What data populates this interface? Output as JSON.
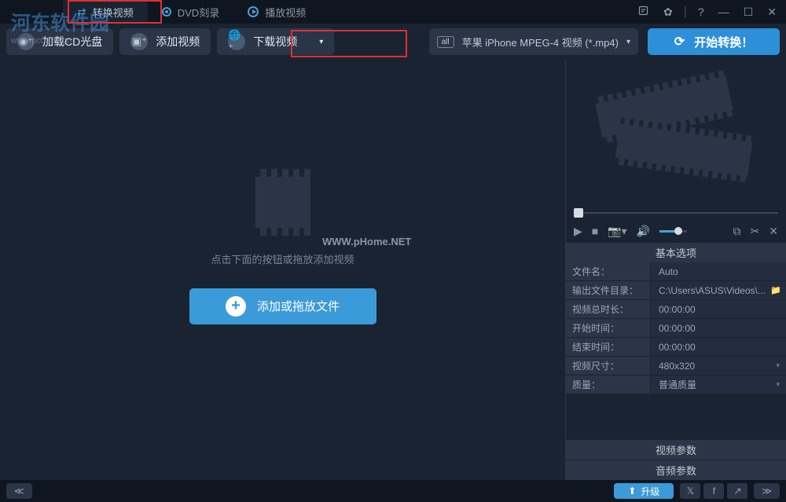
{
  "tabs": {
    "convert": "转换视频",
    "dvd": "DVD刻录",
    "play": "播放视频"
  },
  "titlebar_icons": {
    "edit": "edit-icon",
    "settings": "gear-icon",
    "help": "?",
    "minimize": "—",
    "maximize": "☐",
    "close": "✕"
  },
  "toolbar": {
    "load_cd": "加载CD光盘",
    "add_video": "添加视频",
    "download_video": "下载视频",
    "format_label": "苹果 iPhone MPEG-4 视频 (*.mp4)",
    "convert": "开始转换！"
  },
  "drop_area": {
    "hint": "点击下面的按钮或拖放添加视频",
    "button": "添加或拖放文件"
  },
  "preview": {
    "basic_options_header": "基本选项",
    "video_params_header": "视频参数",
    "audio_params_header": "音频参数"
  },
  "properties": [
    {
      "label": "文件名：",
      "value": "Auto",
      "type": "text"
    },
    {
      "label": "输出文件目录：",
      "value": "C:\\Users\\ASUS\\Videos\\...",
      "type": "folder"
    },
    {
      "label": "视频总时长：",
      "value": "00:00:00",
      "type": "text"
    },
    {
      "label": "开始时间：",
      "value": "00:00:00",
      "type": "text"
    },
    {
      "label": "结束时间：",
      "value": "00:00:00",
      "type": "text"
    },
    {
      "label": "视频尺寸：",
      "value": "480x320",
      "type": "dropdown"
    },
    {
      "label": "质量：",
      "value": "普通质量",
      "type": "dropdown"
    }
  ],
  "footer": {
    "upgrade": "升级"
  },
  "watermarks": {
    "site1": "河东软件园",
    "site1_sub": "www.pc0359.cn",
    "site2": "WWW.pHome.NET"
  }
}
